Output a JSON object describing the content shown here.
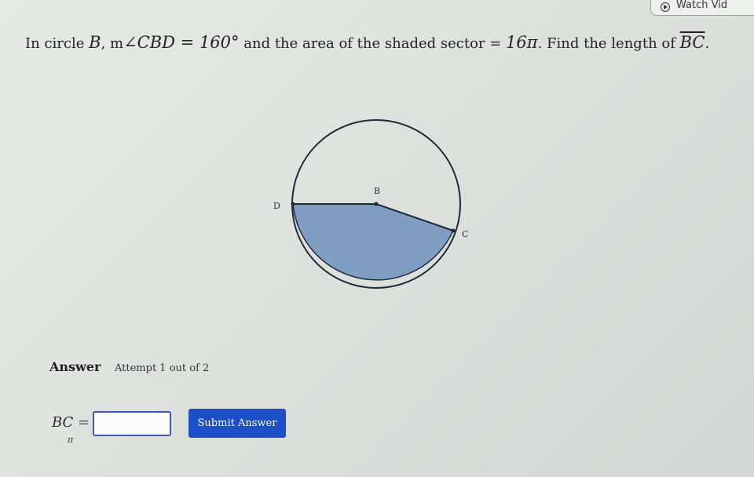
{
  "header": {
    "watch_label": "Watch Vid",
    "watch_icon": "play-circle-icon"
  },
  "question": {
    "intro": "In circle ",
    "circle_name": "B",
    "comma": ", ",
    "angle_m": "m",
    "angle_rest": "∠CBD = 160°",
    "middle": " and the area of the shaded sector = ",
    "area_value": "16π",
    "ending": ". Find the length of ",
    "segment": "BC",
    "period": "."
  },
  "figure": {
    "label_b": "B",
    "label_c": "C",
    "label_d": "D",
    "shade_color": "#7f9ec2",
    "stroke_color": "#1e2a3a"
  },
  "answer": {
    "heading": "Answer",
    "attempt": "Attempt 1 out of 2",
    "field_label": "BC",
    "equals": " =",
    "input_value": "",
    "submit_label": "Submit Answer",
    "pi_key": "π"
  }
}
